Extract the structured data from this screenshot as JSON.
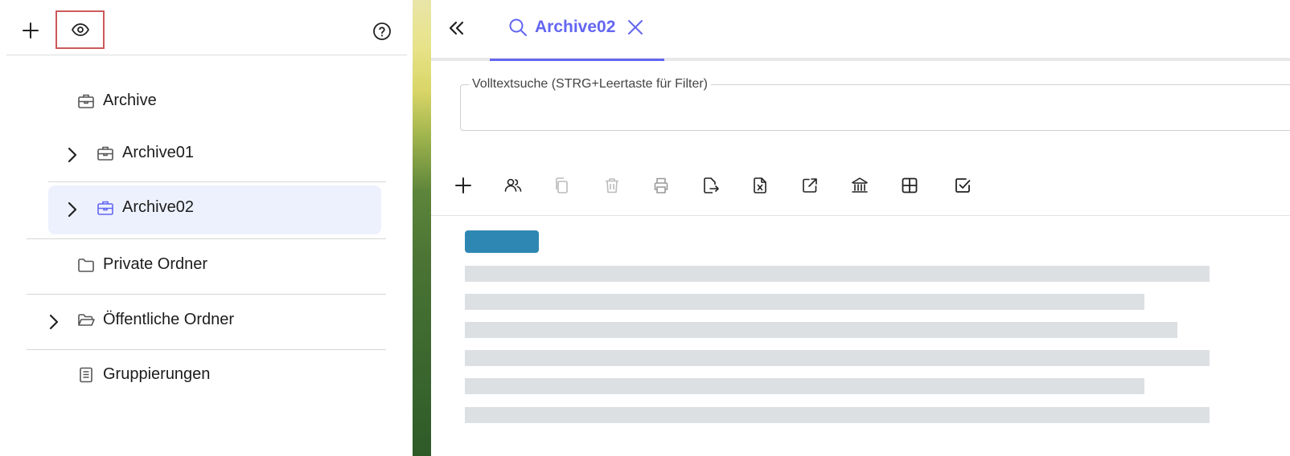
{
  "left_panel": {
    "toolbar": {
      "add_icon": "plus-icon",
      "eye_icon": "eye-icon",
      "help_icon": "question-circle-icon"
    },
    "tree": [
      {
        "label": "Archive",
        "icon": "briefcase-icon",
        "expandable": false
      },
      {
        "label": "Archive01",
        "icon": "briefcase-icon",
        "expandable": true
      },
      {
        "label": "Archive02",
        "icon": "briefcase-icon",
        "expandable": true,
        "selected": true
      },
      {
        "label": "Private Ordner",
        "icon": "folder-icon",
        "expandable": false
      },
      {
        "label": "Öffentliche Ordner",
        "icon": "folder-open-icon",
        "expandable": true
      },
      {
        "label": "Gruppierungen",
        "icon": "document-list-icon",
        "expandable": false
      }
    ]
  },
  "right_panel": {
    "collapse_icon": "double-chevron-left-icon",
    "tab": {
      "label": "Archive02",
      "icon": "search-icon",
      "close_icon": "close-icon"
    },
    "search": {
      "legend": "Volltextsuche (STRG+Leertaste für Filter)",
      "value": ""
    },
    "toolbar_icons": [
      "plus-icon",
      "users-icon",
      "copy-icon",
      "trash-icon",
      "print-icon",
      "export-icon",
      "excel-icon",
      "external-link-icon",
      "bank-icon",
      "grid-icon",
      "checkbox-icon"
    ]
  },
  "colors": {
    "accent": "#6366f1",
    "selected_bg": "#edf1fd",
    "chip": "#2e87b3",
    "skeleton": "#dde0e3",
    "highlight_border": "#cc5a5a"
  }
}
